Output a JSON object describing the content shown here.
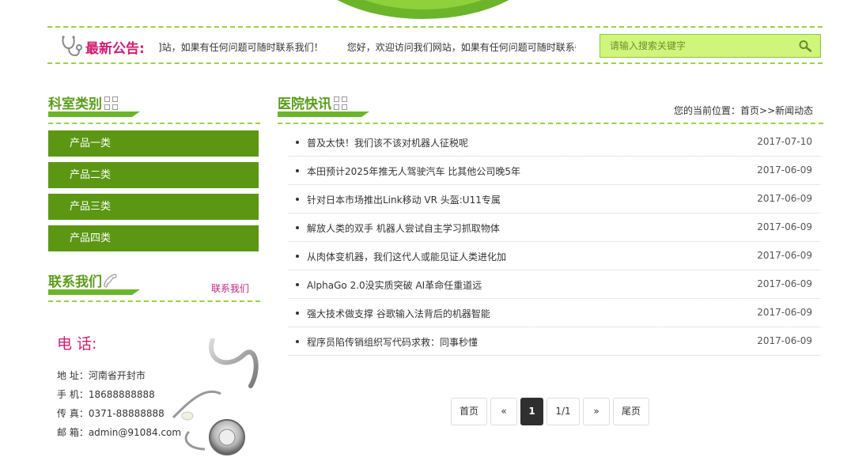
{
  "notice": {
    "label": "最新公告:",
    "text_a": "]站，如果有任何问题可随时联系我们！",
    "text_b": "您好，欢迎访问我们网站，如果有任何问题可随时联系§"
  },
  "search": {
    "placeholder": "请输入搜索关键字"
  },
  "sidebar": {
    "categories_title": "科室类别",
    "categories": [
      "产品一类",
      "产品二类",
      "产品三类",
      "产品四类"
    ],
    "contact_title": "联系我们",
    "contact_link": "联系我们",
    "tel_label": "电 话:",
    "address": "地 址：河南省开封市",
    "mobile": "手 机：18688888888",
    "fax": "传 真：0371-88888888",
    "email": "邮 箱：admin@91084.com"
  },
  "main": {
    "title": "医院快讯",
    "breadcrumb_prefix": "您的当前位置：",
    "breadcrumb_home": "首页",
    "breadcrumb_sep": ">>",
    "breadcrumb_current": "新闻动态",
    "news": [
      {
        "title": "普及太快！我们该不该对机器人征税呢",
        "date": "2017-07-10"
      },
      {
        "title": "本田预计2025年推无人驾驶汽车 比其他公司晚5年",
        "date": "2017-06-09"
      },
      {
        "title": "针对日本市场推出Link移动 VR 头盔:U11专属",
        "date": "2017-06-09"
      },
      {
        "title": "解放人类的双手 机器人尝试自主学习抓取物体",
        "date": "2017-06-09"
      },
      {
        "title": "从肉体变机器，我们这代人或能见证人类进化加",
        "date": "2017-06-09"
      },
      {
        "title": "AlphaGo 2.0没实质突破 AI革命任重道远",
        "date": "2017-06-09"
      },
      {
        "title": "强大技术做支撑 谷歌输入法背后的机器智能",
        "date": "2017-06-09"
      },
      {
        "title": "程序员陷传销组织写代码求救：同事秒懂",
        "date": "2017-06-09"
      }
    ]
  },
  "pager": {
    "first": "首页",
    "prev": "«",
    "current": "1",
    "summary": "1/1",
    "next": "»",
    "last": "尾页"
  },
  "colors": {
    "accent_green": "#5b9713",
    "brand_pink": "#d11d6f",
    "search_bg": "#cff57a"
  }
}
